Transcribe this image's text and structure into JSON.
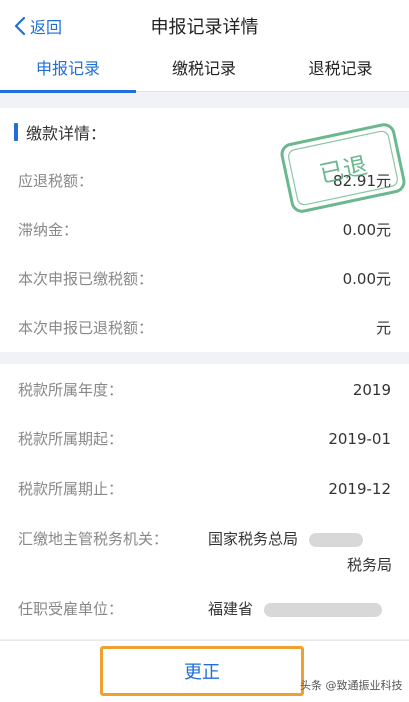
{
  "header": {
    "back_label": "返回",
    "title": "申报记录详情"
  },
  "tabs": [
    {
      "label": "申报记录",
      "active": true
    },
    {
      "label": "缴税记录",
      "active": false
    },
    {
      "label": "退税记录",
      "active": false
    }
  ],
  "payment_section": {
    "title": "缴款详情：",
    "stamp_text": "已退",
    "rows": [
      {
        "label": "应退税额：",
        "value": "82.91元"
      },
      {
        "label": "滞纳金：",
        "value": "0.00元"
      },
      {
        "label": "本次申报已缴税额：",
        "value": "0.00元"
      },
      {
        "label": "本次申报已退税额：",
        "value": "元"
      }
    ]
  },
  "tax_section": {
    "rows": [
      {
        "label": "税款所属年度：",
        "value": "2019"
      },
      {
        "label": "税款所属期起：",
        "value": "2019-01"
      },
      {
        "label": "税款所属期止：",
        "value": "2019-12"
      }
    ],
    "agency_label": "汇缴地主管税务机关：",
    "agency_value_line1": "国家税务总局",
    "agency_value_line2": "税务局",
    "employer_label": "任职受雇单位：",
    "employer_value": "福建省"
  },
  "footer": {
    "correct_button": "更正",
    "watermark": "头条 @致通振业科技"
  },
  "colors": {
    "accent": "#1f6fd8",
    "highlight_border": "#f0a030",
    "stamp": "#3aa06a"
  }
}
